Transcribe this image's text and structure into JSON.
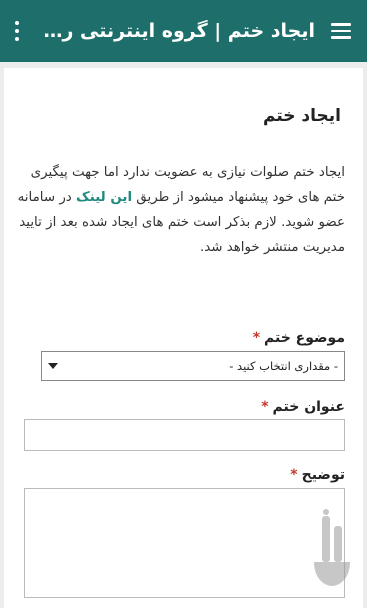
{
  "appbar": {
    "title": "ایجاد ختم | گروه اینترنتی ره...",
    "menu_icon": "hamburger-menu-icon",
    "more_icon": "overflow-menu-icon"
  },
  "page": {
    "heading": "ایجاد ختم",
    "intro_part1": "ایجاد ختم صلوات نیازی به عضویت ندارد اما جهت پیگیری ختم های خود پیشنهاد میشود از طریق ",
    "intro_link": "این لینک",
    "intro_part2": " در سامانه عضو شوید. لازم بذکر است ختم های ایجاد شده بعد از تایید مدیریت منتشر خواهد شد."
  },
  "form": {
    "topic_label": "موضوع ختم",
    "topic_required": "*",
    "topic_value": "- مقداری انتخاب کنید -",
    "title_label": "عنوان ختم",
    "title_required": "*",
    "title_value": "",
    "description_label": "توضیح",
    "description_required": "*",
    "description_value": ""
  },
  "colors": {
    "appbar": "#1e6f6c",
    "link": "#1f8a7f",
    "required": "#c0392b",
    "background": "#ececec"
  }
}
